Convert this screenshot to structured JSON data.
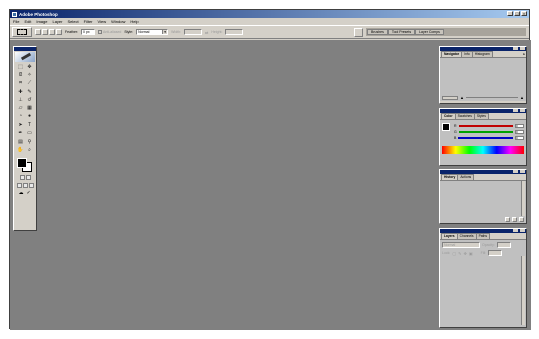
{
  "app": {
    "title": "Adobe Photoshop"
  },
  "menu": [
    "File",
    "Edit",
    "Image",
    "Layer",
    "Select",
    "Filter",
    "View",
    "Window",
    "Help"
  ],
  "options": {
    "feather_label": "Feather:",
    "feather_value": "0 px",
    "anti_aliased_label": "Anti-aliased",
    "style_label": "Style:",
    "style_value": "Normal",
    "width_label": "Width:",
    "height_label": "Height:"
  },
  "palette_well": {
    "tabs": [
      "Brushes",
      "Tool Presets",
      "Layer Comps"
    ]
  },
  "panels": {
    "navigator": {
      "tabs": [
        "Navigator",
        "Info",
        "Histogram"
      ]
    },
    "color": {
      "tabs": [
        "Color",
        "Swatches",
        "Styles"
      ],
      "channels": [
        "R",
        "G",
        "B"
      ],
      "values": [
        "0",
        "0",
        "0"
      ]
    },
    "history": {
      "tabs": [
        "History",
        "Actions"
      ]
    },
    "layers": {
      "tabs": [
        "Layers",
        "Channels",
        "Paths"
      ],
      "blend_mode": "Normal",
      "opacity_label": "Opacity:",
      "lock_label": "Lock:",
      "fill_label": "Fill:"
    }
  },
  "colors": {
    "title_bar": "#0a246a",
    "workspace": "#808080",
    "chrome": "#d4d0c8",
    "red_slider": "#c00000",
    "green_slider": "#00a000",
    "blue_slider": "#0000c0"
  }
}
